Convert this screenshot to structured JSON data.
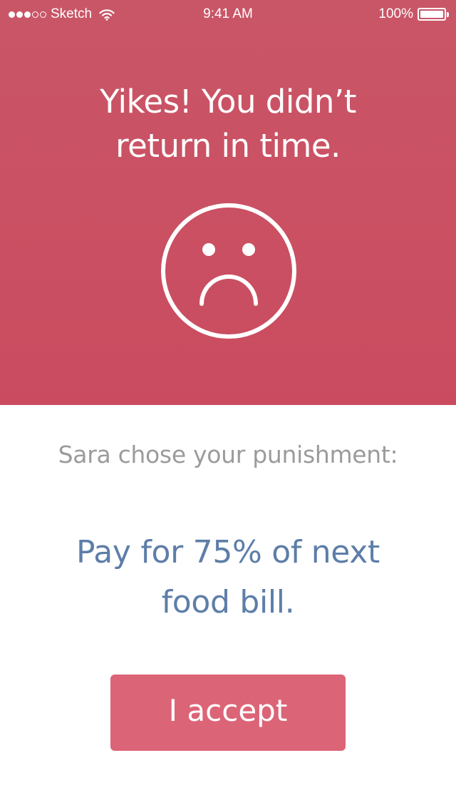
{
  "status_bar": {
    "carrier": "Sketch",
    "time": "9:41 AM",
    "battery_percent": "100%",
    "battery_level": 1.0,
    "signal_filled": 3,
    "signal_total": 5,
    "icons": [
      "signal-dots-icon",
      "wifi-icon",
      "battery-icon"
    ]
  },
  "hero": {
    "title_line1": "Yikes! You didn’t",
    "title_line2": "return in time.",
    "icon": "sad-face-icon",
    "background_color": "#c95266"
  },
  "punishment": {
    "intro": "Sara chose your punishment:",
    "line1": "Pay for 75% of next",
    "line2": "food bill."
  },
  "actions": {
    "accept_label": "I accept",
    "accept_color": "#dc6477"
  },
  "colors": {
    "intro_text": "#9b9b9b",
    "punishment_text": "#5d7ea8",
    "white": "#ffffff"
  }
}
